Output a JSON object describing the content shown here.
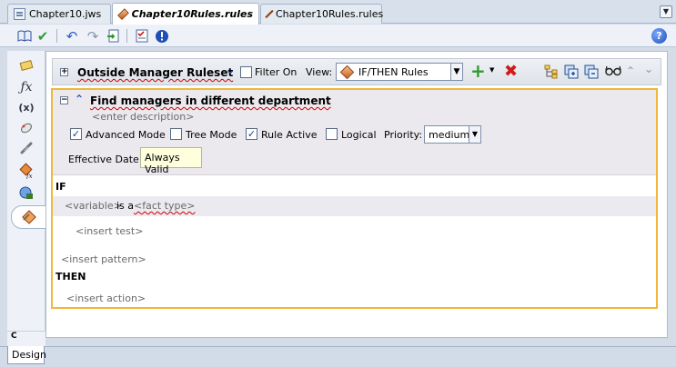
{
  "tabs": [
    {
      "label": "Chapter10.jws",
      "icon": "workspace-icon"
    },
    {
      "label": "Chapter10Rules.rules",
      "icon": "rules-diamond-icon",
      "active": true
    },
    {
      "label": "Chapter10Rules.rules",
      "icon": "rules-diamond-icon"
    }
  ],
  "ruleset": {
    "name": "Outside Manager Ruleset",
    "filter_label": "Filter On",
    "view_label": "View:",
    "view_value": "IF/THEN Rules"
  },
  "rule": {
    "title": "Find managers in different department",
    "description_placeholder": "<enter description>",
    "advanced_mode": "Advanced Mode",
    "tree_mode": "Tree Mode",
    "rule_active": "Rule Active",
    "logical": "Logical",
    "priority_label": "Priority:",
    "priority_value": "medium",
    "effective_date_label": "Effective Date:",
    "effective_date_value": "Always Valid",
    "advanced_mode_checked": true,
    "tree_mode_checked": false,
    "rule_active_checked": true,
    "logical_checked": false
  },
  "body": {
    "if_label": "IF",
    "variable": "<variable>",
    "is_a": "is a",
    "fact_type": "<fact type>",
    "insert_test": "<insert test>",
    "insert_pattern": "<insert pattern>",
    "then_label": "THEN",
    "insert_action": "<insert action>"
  },
  "bottom": {
    "left_label": "C",
    "design_tab": "Design"
  },
  "colors": {
    "accent_border": "#f0b73a",
    "add_green": "#2e9b2e",
    "delete_red": "#d11a1a"
  }
}
